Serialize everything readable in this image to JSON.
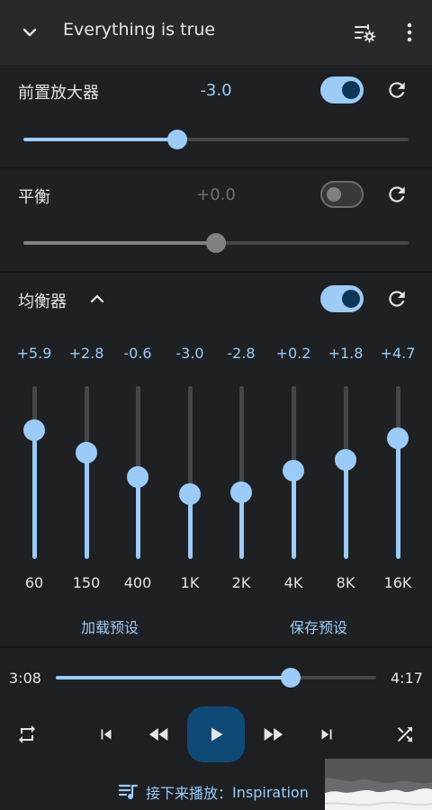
{
  "header": {
    "title": "Everything is true"
  },
  "preamp": {
    "label": "前置放大器",
    "value": "-3.0",
    "enabled": true,
    "level_percent": 40
  },
  "balance": {
    "label": "平衡",
    "value": "+0.0",
    "enabled": false,
    "level_percent": 50
  },
  "equalizer": {
    "label": "均衡器",
    "enabled": true,
    "range_db": [
      -12,
      12
    ],
    "bands": [
      {
        "freq": "60",
        "value": "+5.9",
        "gain": 5.9
      },
      {
        "freq": "150",
        "value": "+2.8",
        "gain": 2.8
      },
      {
        "freq": "400",
        "value": "-0.6",
        "gain": -0.6
      },
      {
        "freq": "1K",
        "value": "-3.0",
        "gain": -3.0
      },
      {
        "freq": "2K",
        "value": "-2.8",
        "gain": -2.8
      },
      {
        "freq": "4K",
        "value": "+0.2",
        "gain": 0.2
      },
      {
        "freq": "8K",
        "value": "+1.8",
        "gain": 1.8
      },
      {
        "freq": "16K",
        "value": "+4.7",
        "gain": 4.7
      }
    ],
    "load_preset": "加载预设",
    "save_preset": "保存预设"
  },
  "player": {
    "elapsed": "3:08",
    "duration": "4:17",
    "progress_fraction": 0.732,
    "up_next_prefix": "接下来播放：",
    "up_next_title": "Inspiration"
  },
  "colors": {
    "accent": "#9ccbf7",
    "play_button": "#0f4a77",
    "background": "#1f2023"
  }
}
